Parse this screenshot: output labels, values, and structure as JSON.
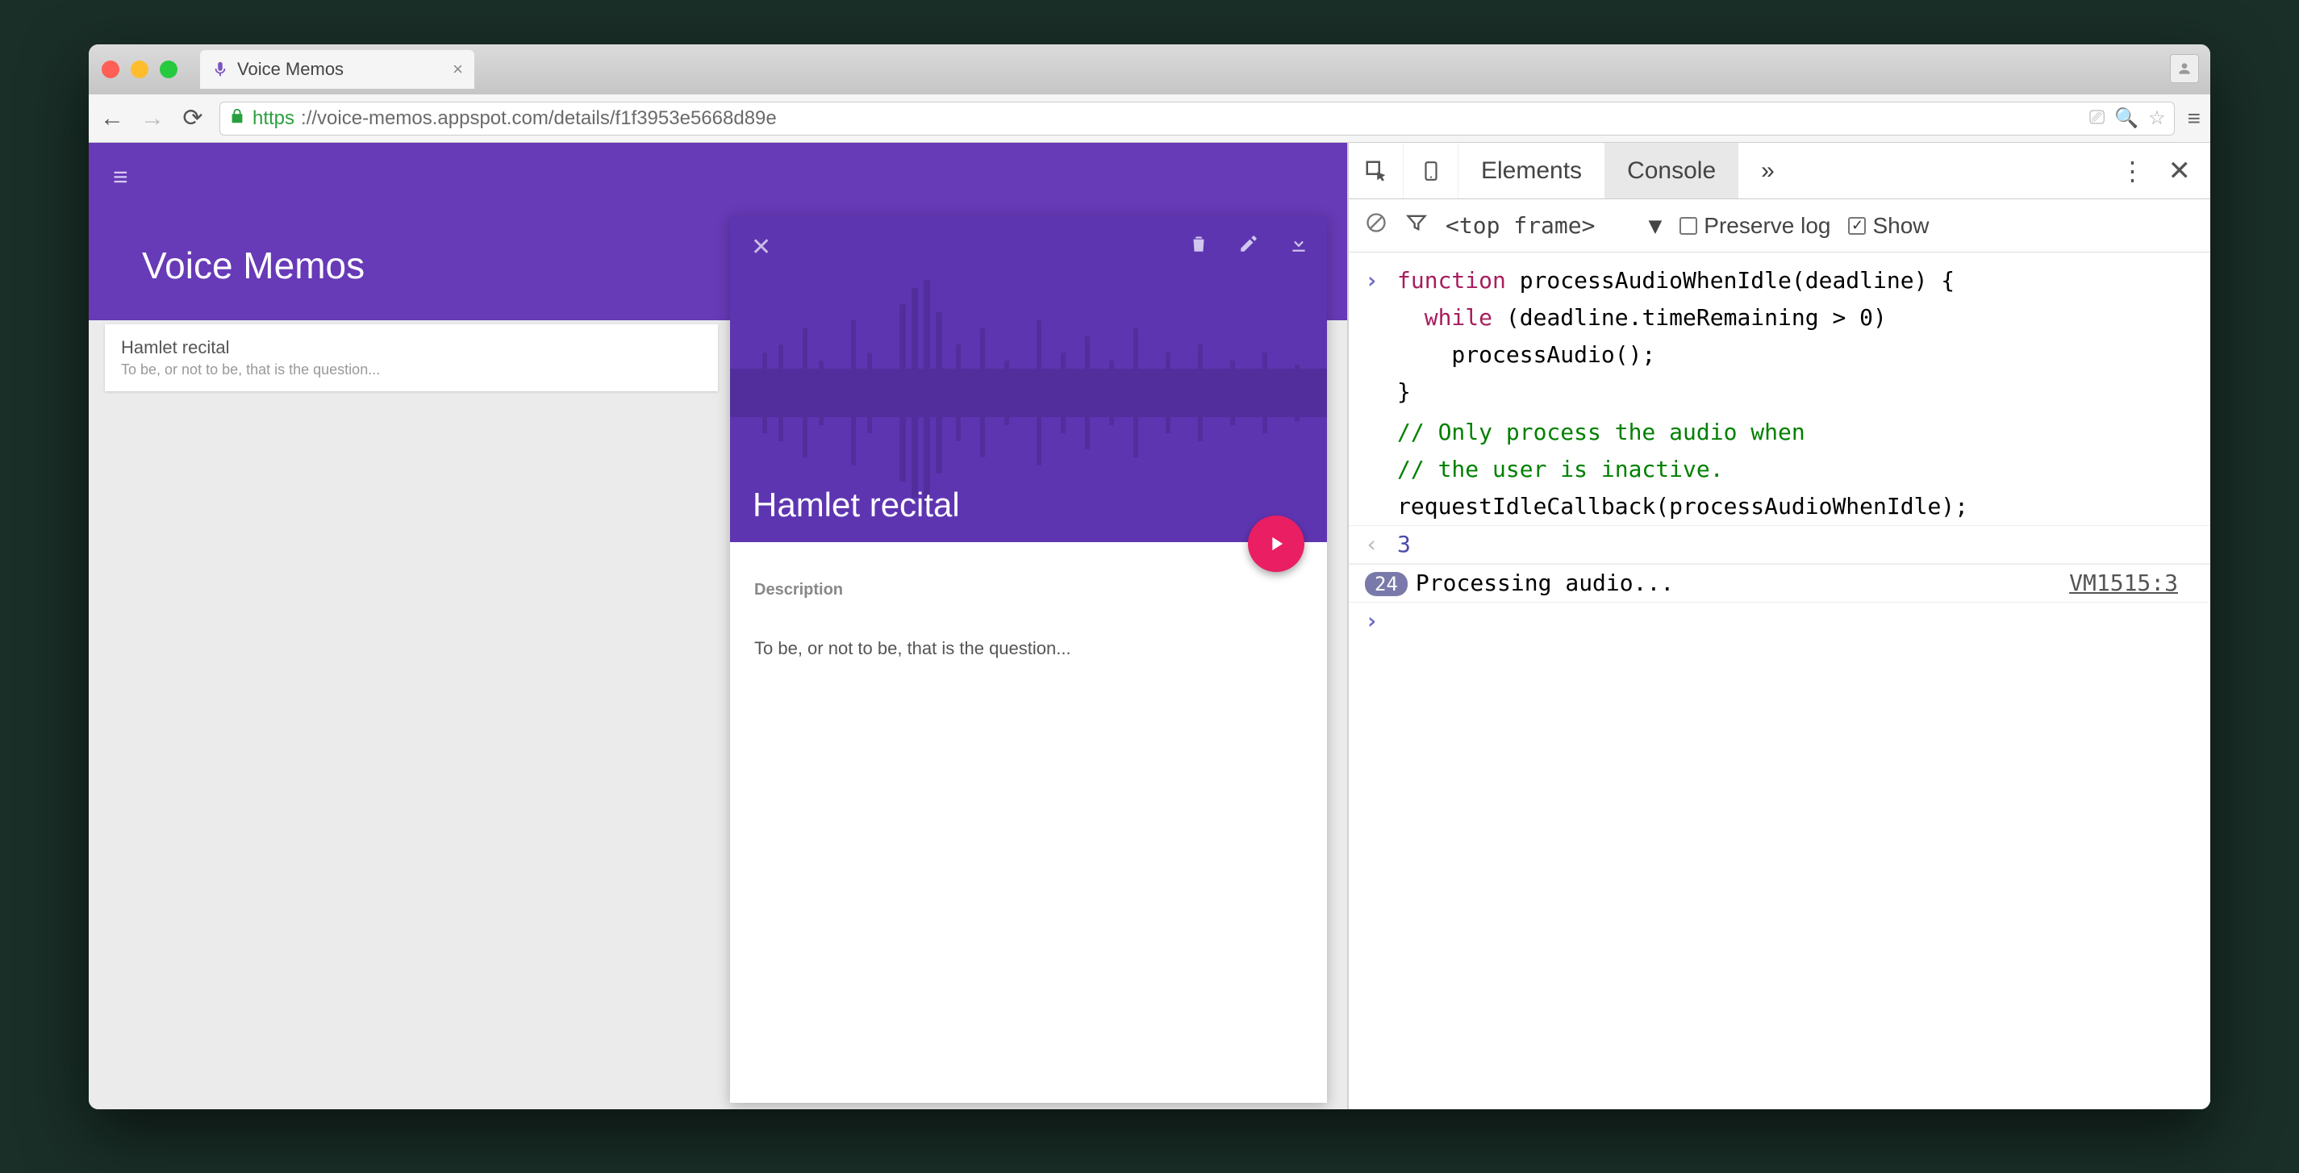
{
  "browser": {
    "tab_title": "Voice Memos",
    "url_secure": "https",
    "url_rest": "://voice-memos.appspot.com/details/f1f3953e5668d89e"
  },
  "app": {
    "title": "Voice Memos",
    "list": [
      {
        "title": "Hamlet recital",
        "subtitle": "To be, or not to be, that is the question..."
      }
    ],
    "detail": {
      "title": "Hamlet recital",
      "desc_label": "Description",
      "desc_text": "To be, or not to be, that is the question..."
    }
  },
  "devtools": {
    "tabs": {
      "elements": "Elements",
      "console": "Console",
      "more": "»"
    },
    "filter": {
      "frame": "<top frame>",
      "preserve_label": "Preserve log",
      "show_label": "Show"
    },
    "console": {
      "code_lines": [
        "function processAudioWhenIdle(deadline) {",
        "  while (deadline.timeRemaining > 0)",
        "    processAudio();",
        "}",
        "",
        "// Only process the audio when",
        "// the user is inactive.",
        "requestIdleCallback(processAudioWhenIdle);"
      ],
      "return_value": "3",
      "log_count": "24",
      "log_message": "Processing audio...",
      "log_source": "VM1515:3",
      "kw_function": "function",
      "kw_while": "while"
    }
  }
}
